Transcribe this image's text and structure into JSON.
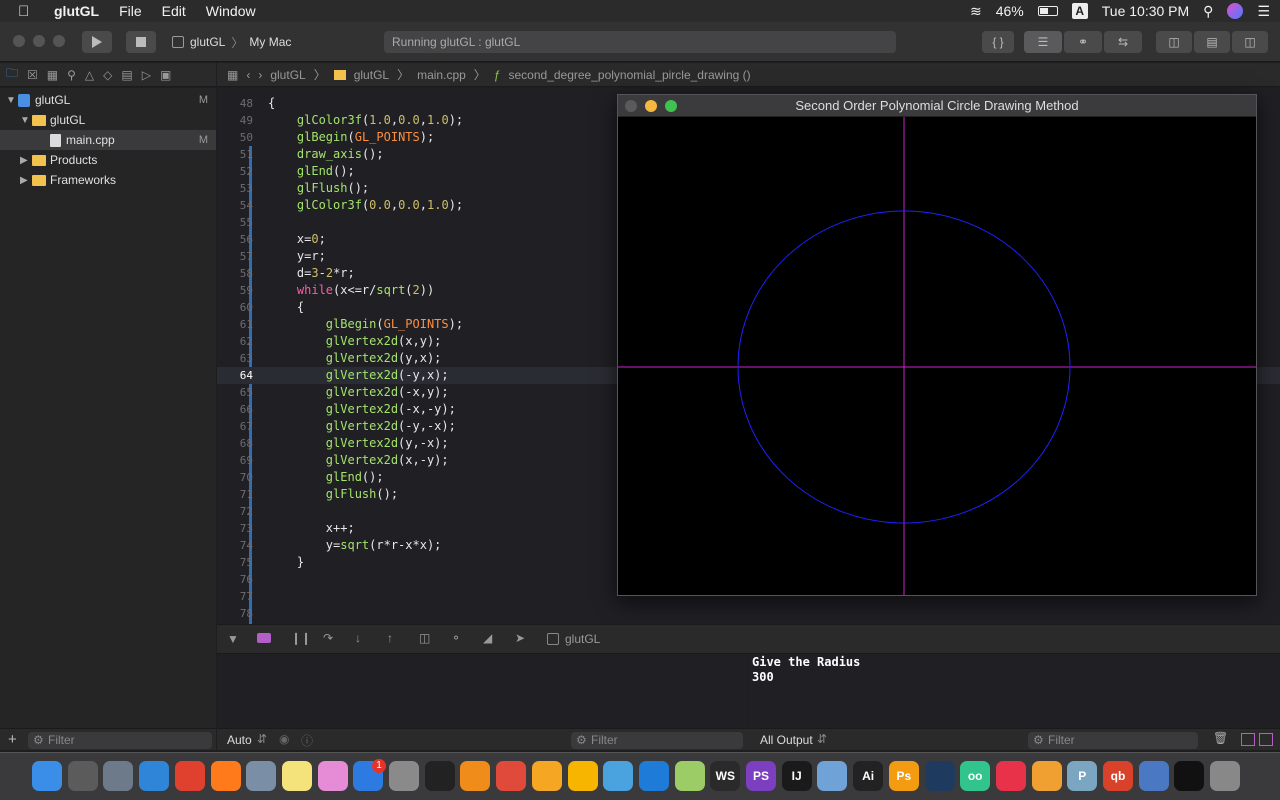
{
  "menubar": {
    "app": "glutGL",
    "items": [
      "File",
      "Edit",
      "Window"
    ],
    "battery": "46%",
    "ime": "A",
    "clock": "Tue 10:30 PM"
  },
  "toolbar": {
    "scheme_target": "glutGL",
    "scheme_device": "My Mac",
    "activity": "Running glutGL : glutGL",
    "braces_label": "{ }"
  },
  "navigator": {
    "project": "glutGL",
    "group": "glutGL",
    "file": "main.cpp",
    "products": "Products",
    "frameworks": "Frameworks",
    "modified_mark": "M",
    "filter_placeholder": "Filter"
  },
  "jumpbar": {
    "crumbs": [
      "glutGL",
      "glutGL",
      "main.cpp",
      "second_degree_polynomial_pircle_drawing ()"
    ]
  },
  "editor": {
    "lines": [
      {
        "n": "48",
        "text": "{"
      },
      {
        "n": "49",
        "text": "    glColor3f(1.0,0.0,1.0);"
      },
      {
        "n": "50",
        "text": "    glBegin(GL_POINTS);"
      },
      {
        "n": "51",
        "text": "    draw_axis();"
      },
      {
        "n": "52",
        "text": "    glEnd();"
      },
      {
        "n": "53",
        "text": "    glFlush();"
      },
      {
        "n": "54",
        "text": "    glColor3f(0.0,0.0,1.0);"
      },
      {
        "n": "55",
        "text": ""
      },
      {
        "n": "56",
        "text": "    x=0;"
      },
      {
        "n": "57",
        "text": "    y=r;"
      },
      {
        "n": "58",
        "text": "    d=3-2*r;"
      },
      {
        "n": "59",
        "text": "    while(x<=r/sqrt(2))"
      },
      {
        "n": "60",
        "text": "    {"
      },
      {
        "n": "61",
        "text": "        glBegin(GL_POINTS);"
      },
      {
        "n": "62",
        "text": "        glVertex2d(x,y);"
      },
      {
        "n": "63",
        "text": "        glVertex2d(y,x);"
      },
      {
        "n": "64",
        "text": "        glVertex2d(-y,x);"
      },
      {
        "n": "65",
        "text": "        glVertex2d(-x,y);"
      },
      {
        "n": "66",
        "text": "        glVertex2d(-x,-y);"
      },
      {
        "n": "67",
        "text": "        glVertex2d(-y,-x);"
      },
      {
        "n": "68",
        "text": "        glVertex2d(y,-x);"
      },
      {
        "n": "69",
        "text": "        glVertex2d(x,-y);"
      },
      {
        "n": "70",
        "text": "        glEnd();"
      },
      {
        "n": "71",
        "text": "        glFlush();"
      },
      {
        "n": "72",
        "text": ""
      },
      {
        "n": "73",
        "text": "        x++;"
      },
      {
        "n": "74",
        "text": "        y=sqrt(r*r-x*x);"
      },
      {
        "n": "75",
        "text": "    }"
      },
      {
        "n": "76",
        "text": ""
      },
      {
        "n": "77",
        "text": ""
      },
      {
        "n": "78",
        "text": ""
      }
    ],
    "current_line": "64"
  },
  "glwindow": {
    "title": "Second Order Polynomial Circle Drawing Method",
    "axis_color": "#cc22cc",
    "circle_color": "#2020ff"
  },
  "debugbar": {
    "process": "glutGL"
  },
  "console": {
    "output": "Give the Radius\n300",
    "scope": "Auto",
    "output_select": "All Output",
    "filter_placeholder": "Filter"
  },
  "dock": {
    "badge": "1",
    "labels": [
      "WS",
      "PS",
      "IJ",
      "Ai",
      "Ps",
      "oo",
      "P",
      "qb"
    ]
  }
}
